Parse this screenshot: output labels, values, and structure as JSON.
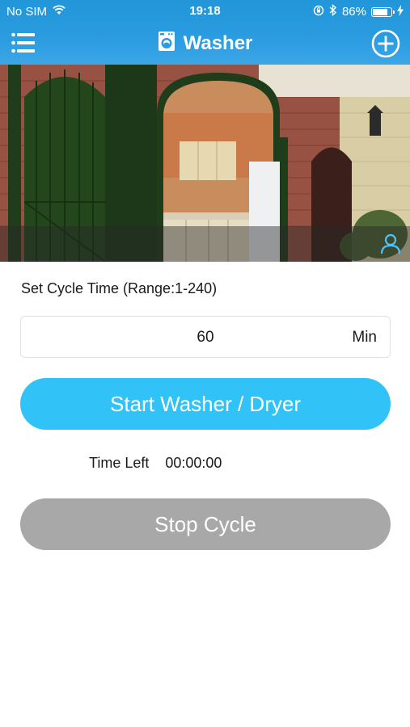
{
  "status_bar": {
    "carrier": "No SIM",
    "time": "19:18",
    "battery_percent": "86%",
    "battery_level": 0.86,
    "icons": [
      "wifi-icon",
      "orientation-lock-icon",
      "bluetooth-icon",
      "battery-icon",
      "charging-bolt-icon"
    ]
  },
  "nav": {
    "title": "Washer",
    "menu_icon": "hamburger-menu-icon",
    "title_icon": "washing-machine-icon",
    "add_icon": "plus-circle-icon"
  },
  "photo": {
    "description_icon": "user-icon"
  },
  "cycle": {
    "label": "Set Cycle Time (Range:1-240)",
    "value": "60",
    "unit": "Min"
  },
  "buttons": {
    "start_label": "Start Washer / Dryer",
    "stop_label": "Stop Cycle"
  },
  "timer": {
    "label": "Time Left",
    "value": "00:00:00"
  },
  "colors": {
    "header_blue": "#2a9be0",
    "start_button": "#31c3f7",
    "stop_button": "#a8a8a8",
    "user_icon": "#4fc3f7"
  }
}
